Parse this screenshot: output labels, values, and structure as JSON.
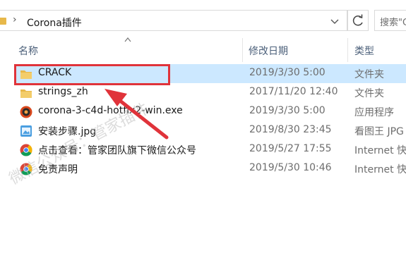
{
  "address": {
    "breadcrumb": "Corona插件",
    "search_placeholder": "搜索\"C"
  },
  "columns": {
    "name": "名称",
    "date": "修改日期",
    "type": "类型"
  },
  "files": [
    {
      "name": "CRACK",
      "date": "2019/3/30 5:00",
      "type": "文件夹",
      "icon": "folder-icon",
      "selected": true
    },
    {
      "name": "strings_zh",
      "date": "2017/11/20 12:40",
      "type": "文件夹",
      "icon": "folder-icon"
    },
    {
      "name": "corona-3-c4d-hotfix2-win.exe",
      "date": "2019/3/30 5:00",
      "type": "应用程序",
      "icon": "corona-app-icon"
    },
    {
      "name": "安装步骤.jpg",
      "date": "2019/8/30 23:45",
      "type": "看图王 JPG",
      "icon": "image-file-icon"
    },
    {
      "name": "点击查看：管家团队旗下微信公众号",
      "date": "2019/5/27 17:55",
      "type": "Internet 快",
      "icon": "chrome-shortcut-icon"
    },
    {
      "name": "免责声明",
      "date": "2019/5/30 10:46",
      "type": "Internet 快",
      "icon": "chrome-shortcut-icon"
    }
  ],
  "watermark": "微信公众号：管家插件",
  "colors": {
    "selection": "#cce8ff",
    "highlight": "#e0333a",
    "folder": "#e7b84a",
    "header_text": "#4c607a"
  }
}
